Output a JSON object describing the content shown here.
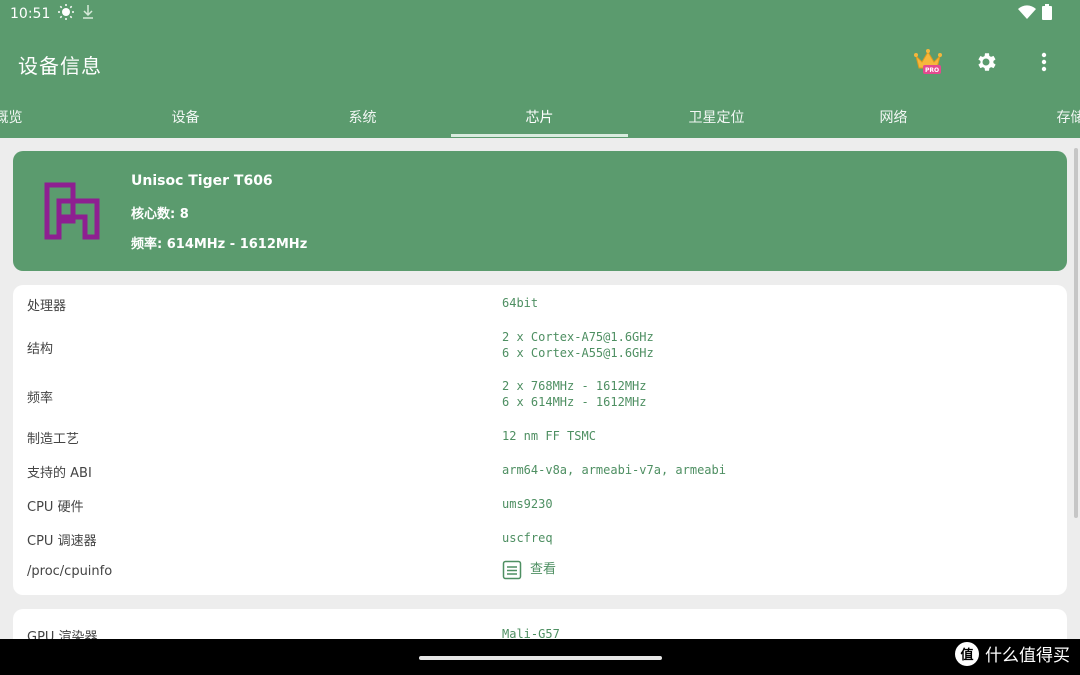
{
  "status_bar": {
    "time": "10:51"
  },
  "toolbar": {
    "title": "设备信息",
    "pro_badge": "PRO",
    "icons": [
      "crown-pro-icon",
      "gear-icon",
      "more-vert-icon"
    ]
  },
  "tabs": [
    {
      "label": "概览"
    },
    {
      "label": "设备"
    },
    {
      "label": "系统"
    },
    {
      "label": "芯片",
      "active": true
    },
    {
      "label": "卫星定位"
    },
    {
      "label": "网络"
    },
    {
      "label": "存储"
    }
  ],
  "chip": {
    "name": "Unisoc Tiger T606",
    "cores": "核心数: 8",
    "frequency": "频率: 614MHz - 1612MHz"
  },
  "cpu_rows": [
    {
      "label": "处理器",
      "value": [
        "64bit"
      ]
    },
    {
      "label": "结构",
      "value": [
        "2 x Cortex-A75@1.6GHz",
        "6 x Cortex-A55@1.6GHz"
      ]
    },
    {
      "label": "频率",
      "value": [
        "2 x 768MHz - 1612MHz",
        "6 x 614MHz - 1612MHz"
      ]
    },
    {
      "label": "制造工艺",
      "value": [
        "12 nm FF TSMC"
      ]
    },
    {
      "label": "支持的 ABI",
      "value": [
        "arm64-v8a, armeabi-v7a, armeabi"
      ]
    },
    {
      "label": "CPU 硬件",
      "value": [
        "ums9230"
      ]
    },
    {
      "label": "CPU 调速器",
      "value": [
        "uscfreq"
      ]
    },
    {
      "label": "/proc/cpuinfo",
      "link_text": "查看"
    }
  ],
  "gpu_rows": [
    {
      "label": "GPU 渲染器",
      "value": [
        "Mali-G57"
      ]
    }
  ],
  "watermark": {
    "badge": "值",
    "text": "什么值得买"
  },
  "colors": {
    "primary": "#5b9b6e",
    "accent_text": "#4e8f62",
    "logo": "#8e1f91"
  }
}
